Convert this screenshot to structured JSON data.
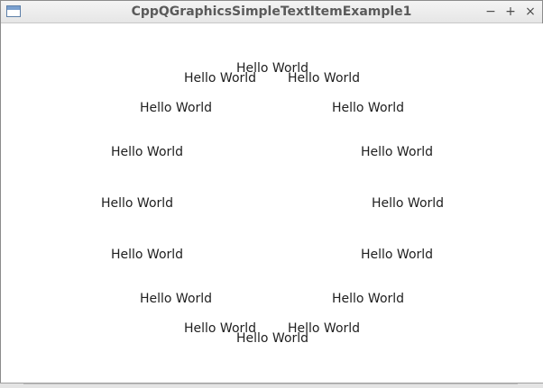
{
  "window": {
    "title": "CppQGraphicsSimpleTextItemExample1",
    "icon": "app-window-icon",
    "buttons": {
      "minimize": "−",
      "maximize": "+",
      "close": "×"
    }
  },
  "scene": {
    "items": [
      "Hello World",
      "Hello World",
      "Hello World",
      "Hello World",
      "Hello World",
      "Hello World",
      "Hello World",
      "Hello World",
      "Hello World",
      "Hello World",
      "Hello World",
      "Hello World",
      "Hello World",
      "Hello World",
      "Hello World",
      "Hello World"
    ]
  }
}
